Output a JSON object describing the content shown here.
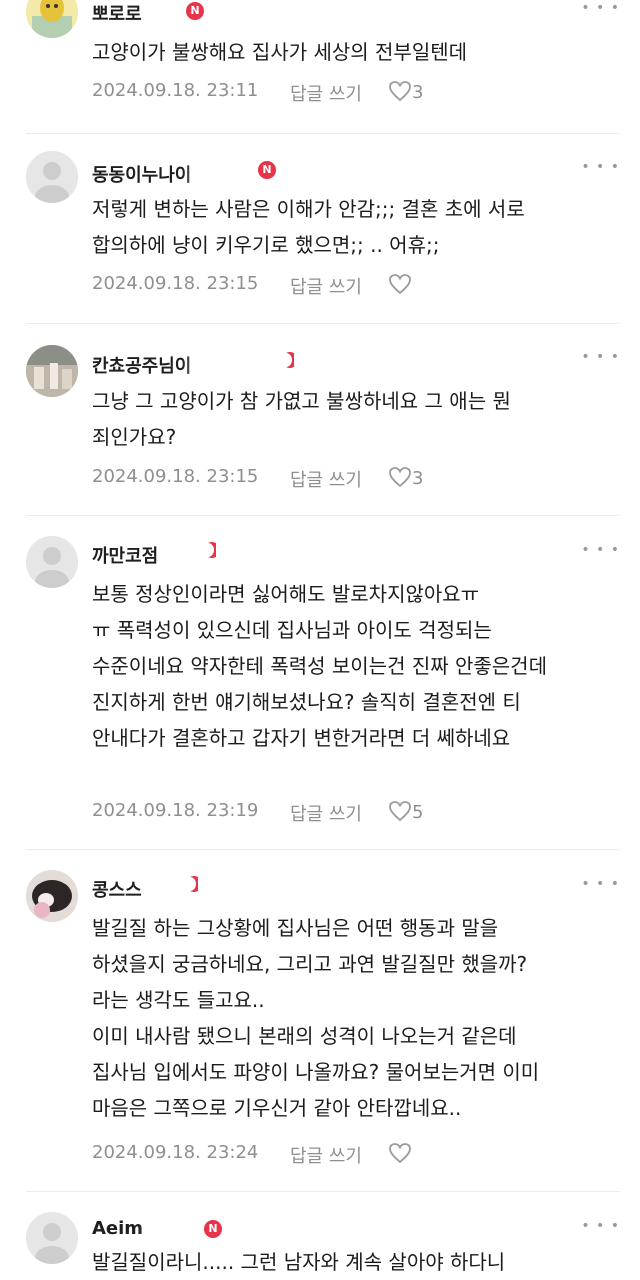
{
  "comments": [
    {
      "nickname": "뽀로로",
      "badge": "N",
      "text": "고양이가 불쌍해요 집사가 세상의 전부일텐데",
      "date": "2024.09.18. 23:11",
      "reply_label": "답글 쓰기",
      "likes": "3"
    },
    {
      "nickname": "동동이누나이",
      "badge": "N",
      "text": "저렇게 변하는 사람은 이해가 안감;;; 결혼 초에 서로\n합의하에 냥이 키우기로 했으면;; .. 어휴;;",
      "date": "2024.09.18. 23:15",
      "reply_label": "답글 쓰기",
      "likes": ""
    },
    {
      "nickname": "칸쵸공주님이",
      "badge": "",
      "text": "그냥 그 고양이가 참 가엾고 불쌍하네요 그 애는 뭔\n죄인가요?",
      "date": "2024.09.18. 23:15",
      "reply_label": "답글 쓰기",
      "likes": "3"
    },
    {
      "nickname": "까만코점",
      "badge": "",
      "text": "보통 정상인이라면 싫어해도 발로차지않아요ㅠ\nㅠ 폭력성이 있으신데 집사님과 아이도 걱정되는\n수준이네요 약자한테 폭력성 보이는건 진짜 안좋은건데\n진지하게 한번 얘기해보셨나요? 솔직히 결혼전엔 티\n안내다가 결혼하고 갑자기 변한거라면 더 쎄하네요",
      "date": "2024.09.18. 23:19",
      "reply_label": "답글 쓰기",
      "likes": "5"
    },
    {
      "nickname": "콩스스",
      "badge": "",
      "text": "발길질 하는 그상황에 집사님은 어떤 행동과 말을\n하셨을지 궁금하네요, 그리고 과연 발길질만 했을까?\n라는 생각도 들고요..\n이미 내사람 됐으니 본래의 성격이 나오는거 같은데\n집사님 입에서도 파양이 나올까요? 물어보는거면 이미\n마음은 그쪽으로 기우신거 같아 안타깝네요..",
      "date": "2024.09.18. 23:24",
      "reply_label": "답글 쓰기",
      "likes": ""
    },
    {
      "nickname": "Aeim",
      "badge": "N",
      "text": "발길질이라니..... 그런 남자와 계속 살아야 하다니",
      "date": "",
      "reply_label": "",
      "likes": ""
    }
  ],
  "icons": {
    "more": "more-dots-icon",
    "like": "heart-outline-icon",
    "badge_color": "#e6344a"
  }
}
